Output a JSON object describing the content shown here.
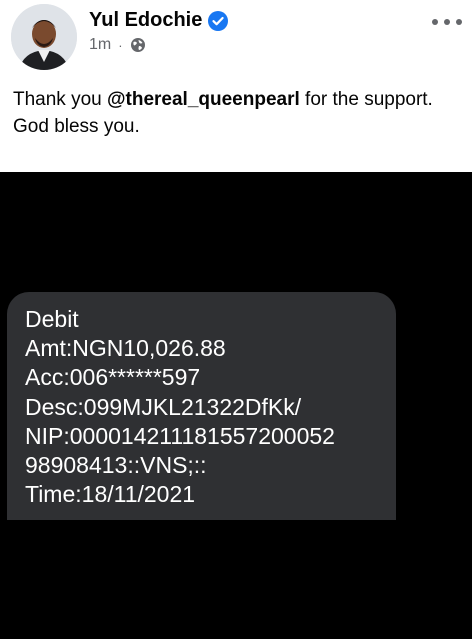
{
  "post": {
    "author": "Yul Edochie",
    "timestamp": "1m",
    "separator": "·",
    "caption_before": "Thank you ",
    "mention": "@thereal_queenpearl",
    "caption_after": " for the support.",
    "caption_line2": "God bless you.",
    "icons": {
      "verified": "verified-badge-icon",
      "privacy": "globe-icon",
      "menu": "more-options-icon"
    },
    "colors": {
      "verified": "#1877f2",
      "meta": "#65676b",
      "text": "#050505"
    }
  },
  "sms": {
    "lines": [
      "Debit",
      "Amt:NGN10,026.88",
      "Acc:006******597",
      "Desc:099MJKL21322DfKk/",
      "NIP:000014211181557200052",
      "98908413::VNS;::",
      "Time:18/11/2021"
    ],
    "bubble_color": "#2f3033"
  }
}
